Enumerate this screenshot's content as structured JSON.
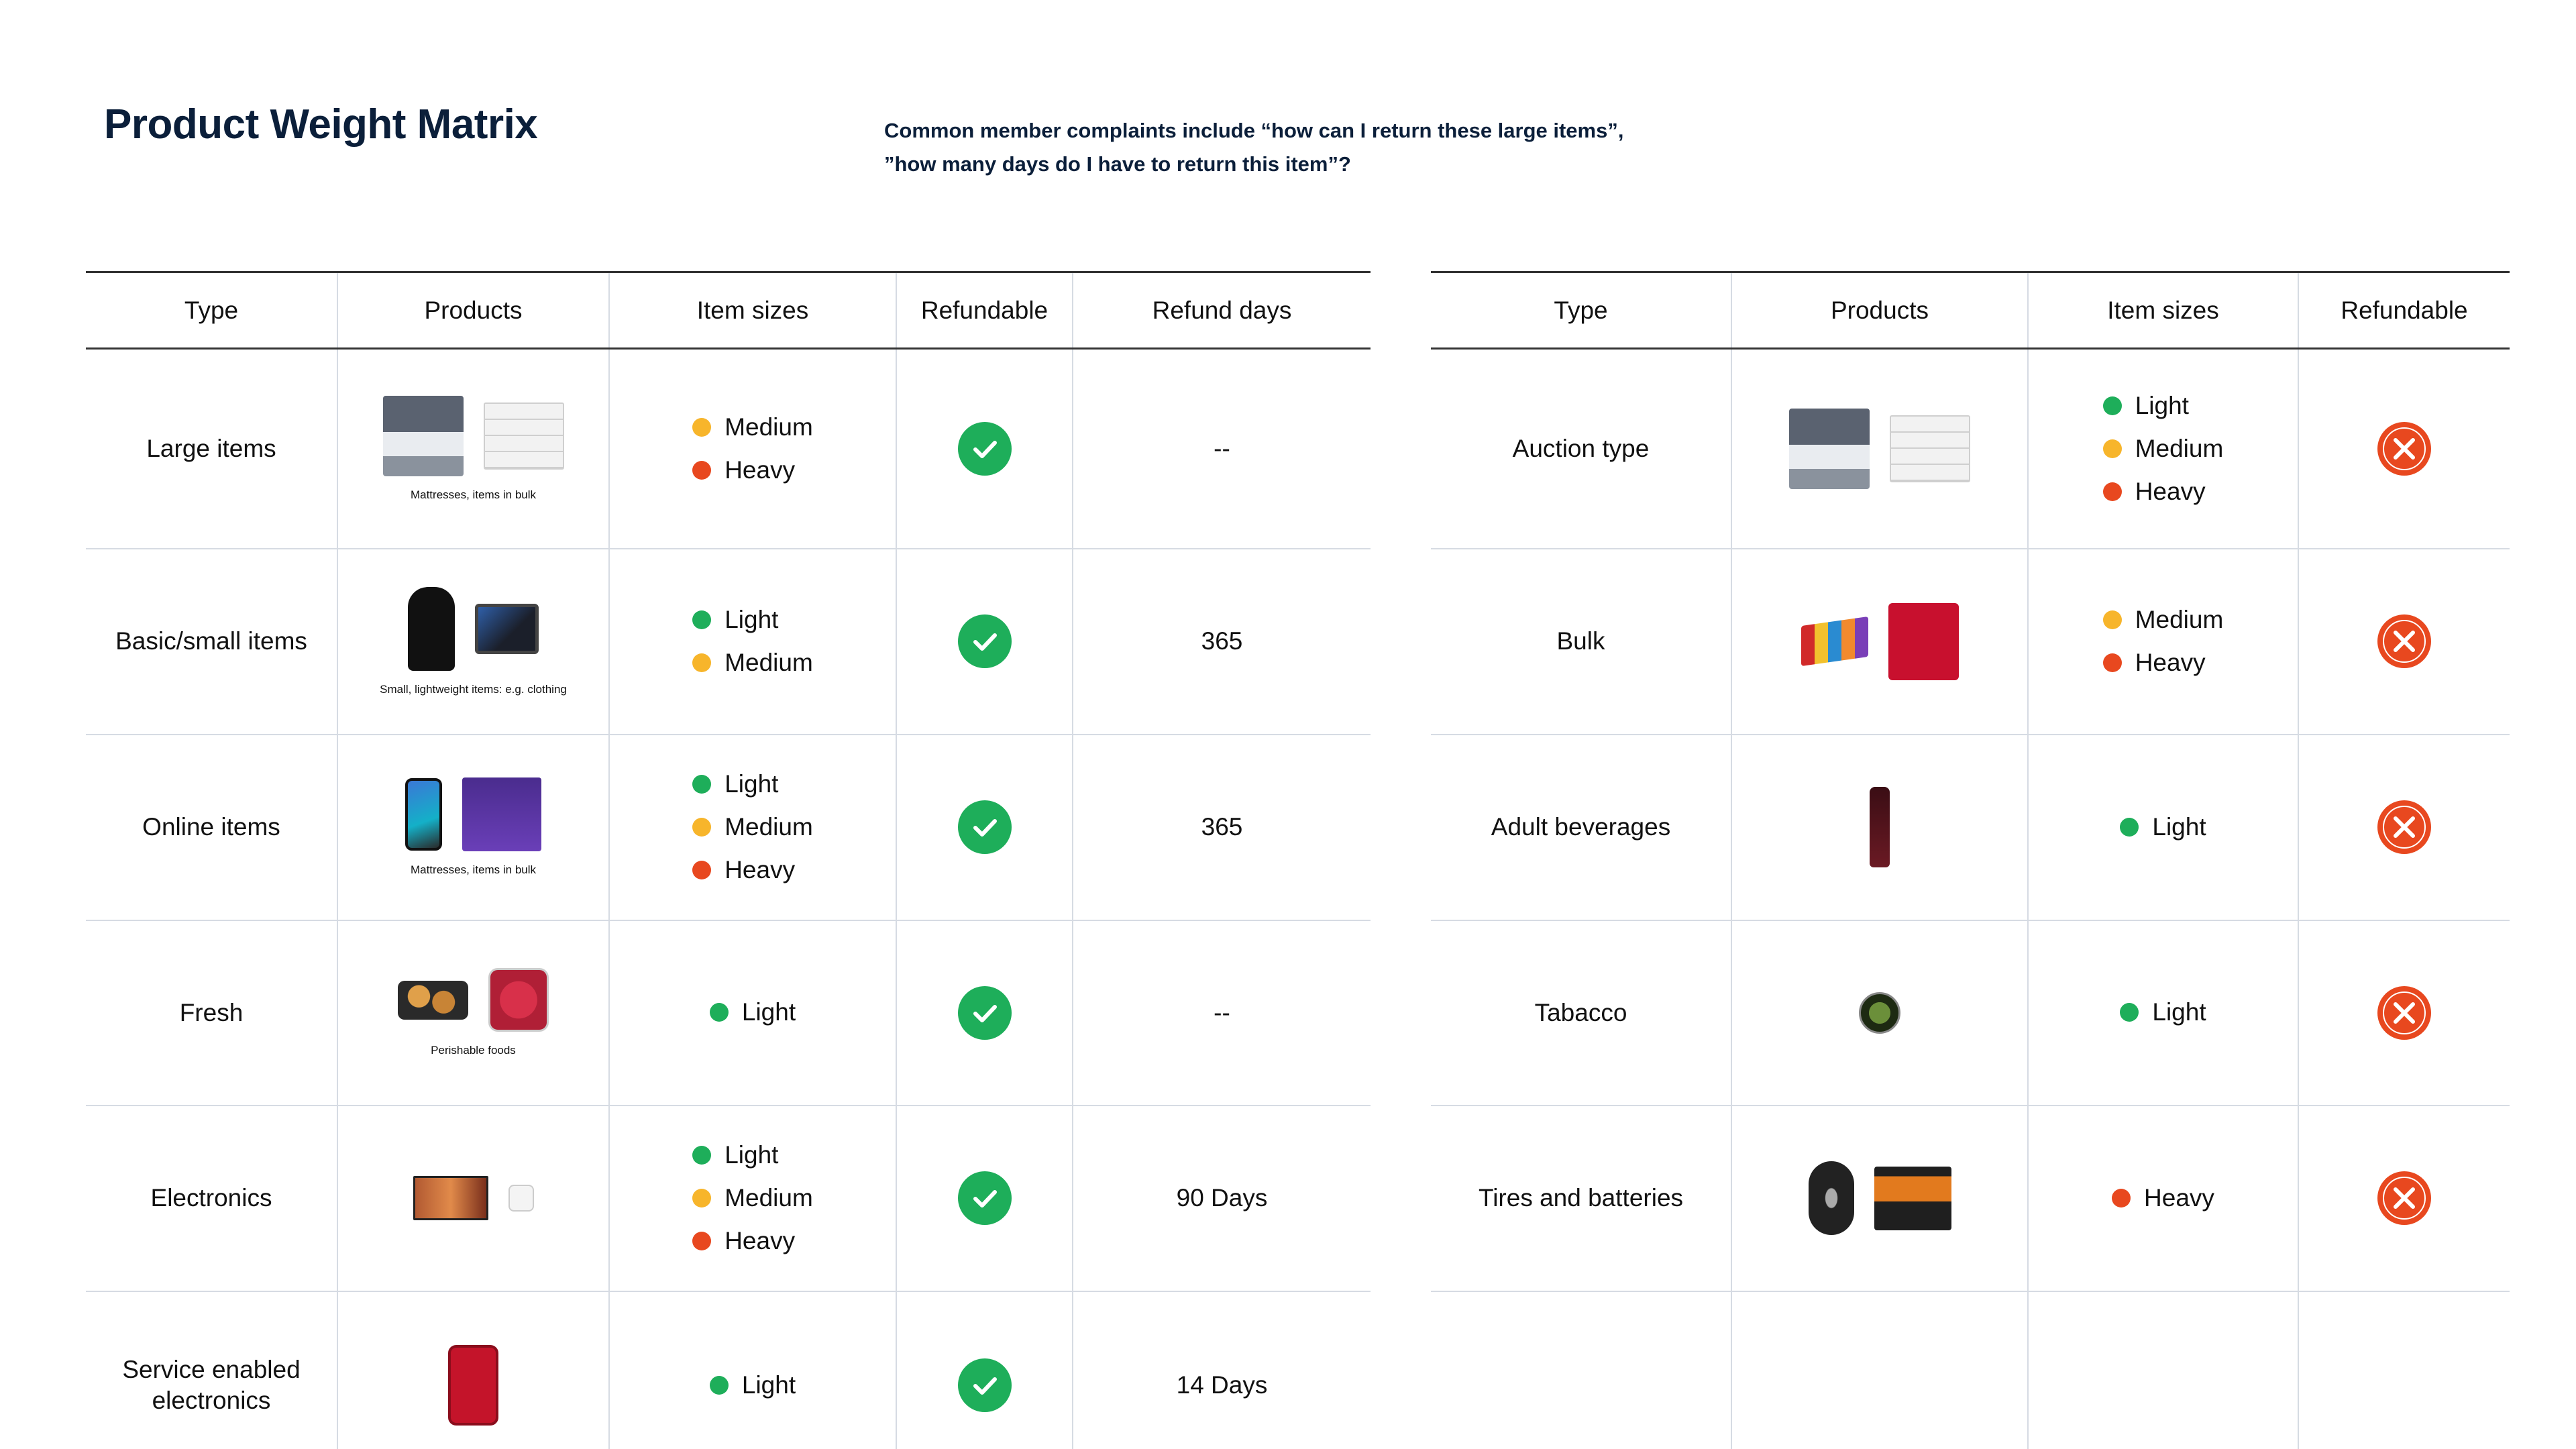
{
  "header": {
    "title": "Product Weight Matrix",
    "note_line1": "Common member complaints include “how can I return these large items”,",
    "note_line2": "”how many days do I have to return this item”?"
  },
  "colors": {
    "light": "#1eae5a",
    "medium": "#f7b52b",
    "heavy": "#e8481f",
    "refundable": "#1eae5a",
    "not_refundable": "#e8481f"
  },
  "left_table": {
    "headers": [
      "Type",
      "Products",
      "Item sizes",
      "Refundable",
      "Refund days"
    ],
    "rows": [
      {
        "type": "Large items",
        "caption": "Mattresses, items in bulk",
        "sizes": [
          "Medium",
          "Heavy"
        ],
        "refundable": true,
        "days": "--",
        "icons": [
          "mattress-icon",
          "dresser-icon"
        ]
      },
      {
        "type": "Basic/small items",
        "caption": "Small, lightweight items: e.g. clothing",
        "sizes": [
          "Light",
          "Medium"
        ],
        "refundable": true,
        "days": "365",
        "icons": [
          "shirt-icon",
          "tablet-icon"
        ]
      },
      {
        "type": "Online items",
        "caption": "Mattresses, items in bulk",
        "sizes": [
          "Light",
          "Medium",
          "Heavy"
        ],
        "refundable": true,
        "days": "365",
        "icons": [
          "phone-icon",
          "snack-box-icon"
        ]
      },
      {
        "type": "Fresh",
        "caption": "Perishable foods",
        "sizes": [
          "Light"
        ],
        "refundable": true,
        "days": "--",
        "icons": [
          "food-tray-icon",
          "berries-icon"
        ]
      },
      {
        "type": "Electronics",
        "caption": "",
        "sizes": [
          "Light",
          "Medium",
          "Heavy"
        ],
        "refundable": true,
        "days": "90 Days",
        "icons": [
          "tv-icon",
          "power-adapter-icon"
        ]
      },
      {
        "type_line1": "Service enabled",
        "type_line2": "electronics",
        "caption": "",
        "sizes": [
          "Light"
        ],
        "refundable": true,
        "days": "14 Days",
        "icons": [
          "smartphone-icon"
        ]
      }
    ]
  },
  "right_table": {
    "headers": [
      "Type",
      "Products",
      "Item sizes",
      "Refundable"
    ],
    "rows": [
      {
        "type": "Auction type",
        "sizes": [
          "Light",
          "Medium",
          "Heavy"
        ],
        "refundable": false,
        "icons": [
          "mattress-icon",
          "dresser-icon"
        ]
      },
      {
        "type": "Bulk",
        "sizes": [
          "Medium",
          "Heavy"
        ],
        "refundable": false,
        "icons": [
          "candy-bars-icon",
          "candy-box-icon"
        ]
      },
      {
        "type": "Adult beverages",
        "sizes": [
          "Light"
        ],
        "refundable": false,
        "icons": [
          "wine-bottle-icon"
        ]
      },
      {
        "type": "Tabacco",
        "sizes": [
          "Light"
        ],
        "refundable": false,
        "icons": [
          "tobacco-tin-icon"
        ]
      },
      {
        "type": "Tires and batteries",
        "sizes": [
          "Heavy"
        ],
        "refundable": false,
        "icons": [
          "tire-icon",
          "car-battery-icon"
        ]
      }
    ]
  }
}
